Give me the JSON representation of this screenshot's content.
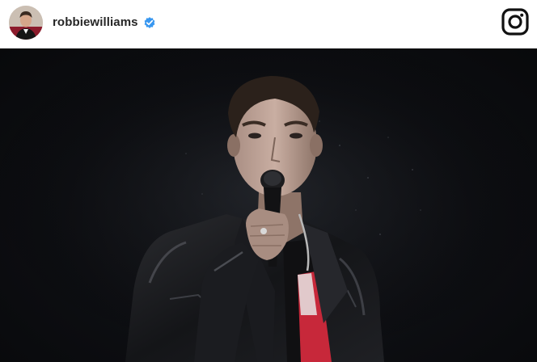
{
  "post": {
    "username": "robbiewilliams",
    "verified_icon": "verified-badge-icon",
    "app_logo_icon": "instagram-logo-icon",
    "accent_color": "#3897f0",
    "text_color": "#262626"
  }
}
